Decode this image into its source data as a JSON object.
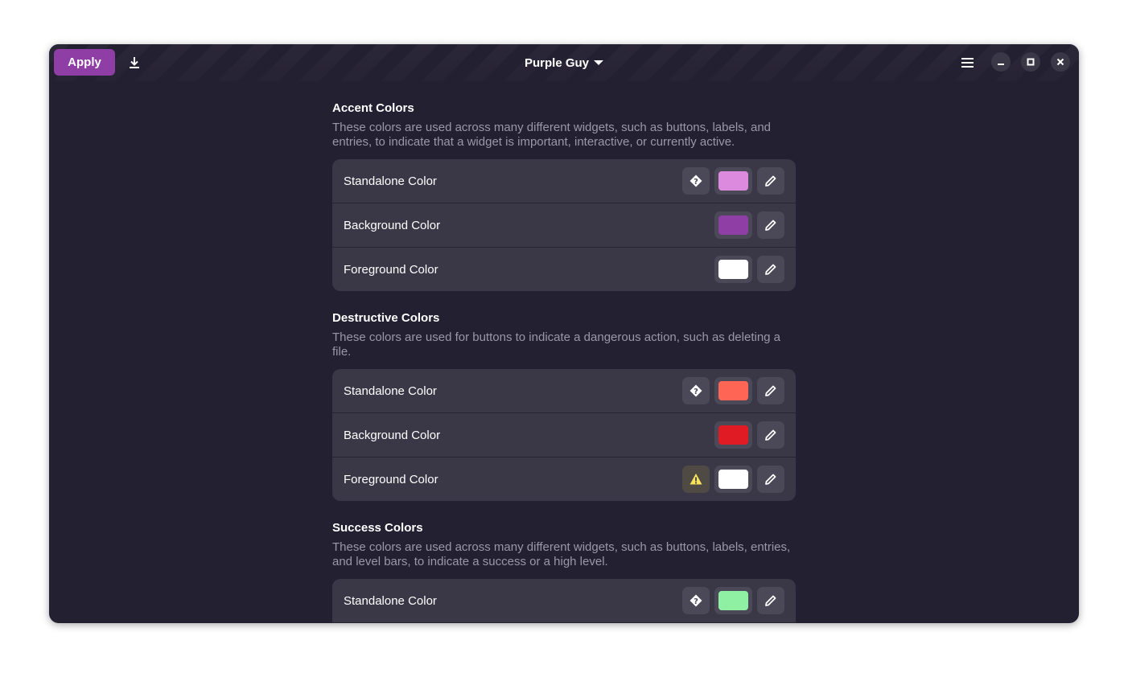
{
  "header": {
    "apply_label": "Apply",
    "title": "Purple Guy",
    "icons": {
      "download": "download-icon",
      "dropdown": "triangle-down-icon",
      "menu": "hamburger-menu-icon",
      "minimize": "minimize-icon",
      "maximize": "maximize-icon",
      "close": "close-icon"
    }
  },
  "colors": {
    "accent": "#8f3ea6",
    "window_bg": "#232032",
    "card_bg": "#3a3747",
    "warning": "#f8e45c"
  },
  "sections": [
    {
      "title": "Accent Colors",
      "description": "These colors are used across many different widgets, such as buttons, labels, and entries, to indicate that a widget is important, interactive, or currently active.",
      "rows": [
        {
          "label": "Standalone Color",
          "status": "unknown",
          "color": "#dc8add"
        },
        {
          "label": "Background Color",
          "status": "none",
          "color": "#8f3ea6"
        },
        {
          "label": "Foreground Color",
          "status": "none",
          "color": "#ffffff"
        }
      ]
    },
    {
      "title": "Destructive Colors",
      "description": "These colors are used for buttons to indicate a dangerous action, such as deleting a file.",
      "rows": [
        {
          "label": "Standalone Color",
          "status": "unknown",
          "color": "#ff6554"
        },
        {
          "label": "Background Color",
          "status": "none",
          "color": "#e01b24"
        },
        {
          "label": "Foreground Color",
          "status": "warning",
          "color": "#ffffff"
        }
      ]
    },
    {
      "title": "Success Colors",
      "description": "These colors are used across many different widgets, such as buttons, labels, entries, and level bars, to indicate a success or a high level.",
      "rows": [
        {
          "label": "Standalone Color",
          "status": "unknown",
          "color": "#8ff0a4"
        }
      ]
    }
  ]
}
